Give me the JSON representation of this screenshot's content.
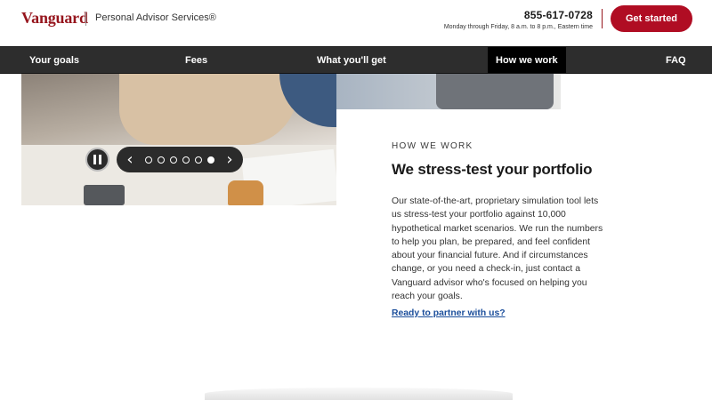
{
  "header": {
    "logo_text": "Vanguard",
    "service_name": "Personal Advisor Services®",
    "phone": "855-617-0728",
    "hours": "Monday through Friday, 8 a.m. to 8 p.m., Eastern time",
    "cta_label": "Get started"
  },
  "nav": {
    "items": [
      {
        "label": "Your goals"
      },
      {
        "label": "Fees"
      },
      {
        "label": "What you'll get"
      },
      {
        "label": "How we work",
        "active": true
      },
      {
        "label": "FAQ"
      }
    ]
  },
  "carousel": {
    "slide_count": 6,
    "active_slide": 6,
    "prev_icon": "chevron-left-icon",
    "next_icon": "chevron-right-icon",
    "pause_icon": "pause-icon"
  },
  "section": {
    "kicker": "HOW WE WORK",
    "headline": "We stress-test your portfolio",
    "body": "Our state-of-the-art, proprietary simulation tool lets us stress-test your portfolio against 10,000 hypothetical market scenarios. We run the numbers to help you plan, be prepared, and feel confident about your financial future. And if circumstances change, or you need a check-in, just contact a Vanguard advisor who's focused on helping you reach your goals.",
    "link_text": "Ready to partner with us?"
  },
  "colors": {
    "brand": "#96151d",
    "cta": "#b00d23",
    "nav_bg": "#2d2d2d",
    "link": "#1b4e9b"
  }
}
